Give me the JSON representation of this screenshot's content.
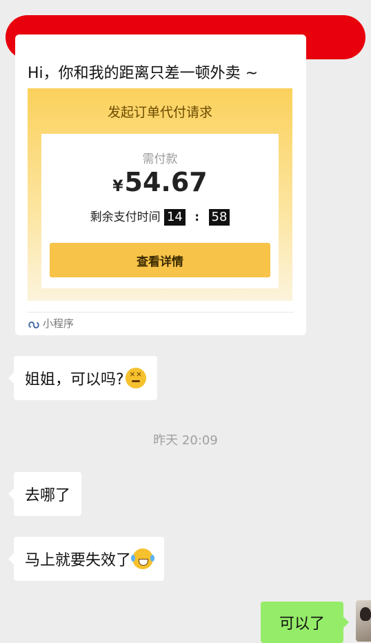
{
  "card": {
    "message": "Hi，你和我的距离只差一顿外卖 ~",
    "mini_program": {
      "title": "发起订单代付请求",
      "pay_label": "需付款",
      "currency_symbol": "¥",
      "amount": "54.67",
      "time_label": "剩余支付时间",
      "minutes": "14",
      "seconds": "58",
      "detail_button": "查看详情"
    },
    "tag_label": "小程序",
    "tag_icon": "mini-program-icon"
  },
  "messages": [
    {
      "text": "姐姐，可以吗?",
      "emoji": "dizzy-face-emoji"
    },
    {
      "text": "去哪了"
    },
    {
      "text": "马上就要失效了",
      "emoji": "tears-of-joy-emoji"
    }
  ],
  "timestamp": "昨天 20:09",
  "reply": {
    "text": "可以了"
  },
  "colors": {
    "redaction": "#e8000c",
    "sent_bubble": "#95ec69",
    "accent": "#f7c348"
  }
}
